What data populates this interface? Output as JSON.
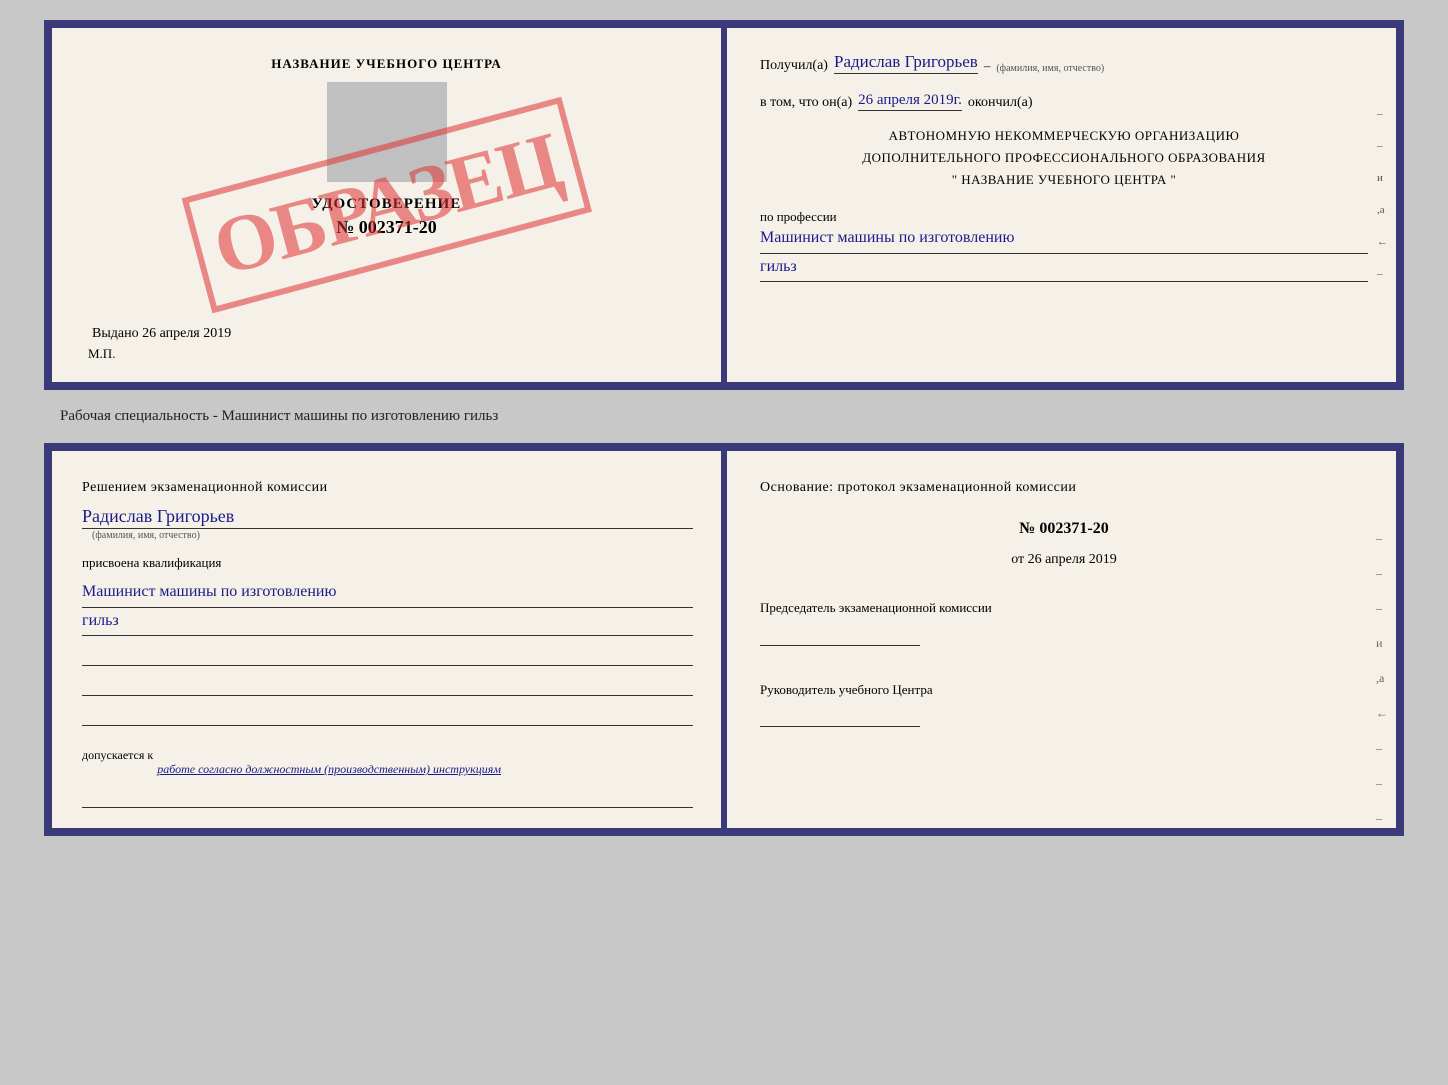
{
  "top_doc": {
    "left": {
      "title": "НАЗВАНИЕ УЧЕБНОГО ЦЕНТРА",
      "watermark": "ОБРАЗЕЦ",
      "cert_label": "УДОСТОВЕРЕНИЕ",
      "cert_number": "№ 002371-20",
      "issued_label": "Выдано",
      "issued_date": "26 апреля 2019",
      "mp_label": "М.П."
    },
    "right": {
      "received_prefix": "Получил(а)",
      "received_name": "Радислав Григорьев",
      "name_note": "(фамилия, имя, отчество)",
      "date_prefix": "в том, что он(а)",
      "date_value": "26 апреля 2019г.",
      "date_suffix": "окончил(а)",
      "org_line1": "АВТОНОМНУЮ НЕКОММЕРЧЕСКУЮ ОРГАНИЗАЦИЮ",
      "org_line2": "ДОПОЛНИТЕЛЬНОГО ПРОФЕССИОНАЛЬНОГО ОБРАЗОВАНИЯ",
      "org_line3": "\" НАЗВАНИЕ УЧЕБНОГО ЦЕНТРА \"",
      "profession_label": "по профессии",
      "profession_name": "Машинист машины по изготовлению",
      "profession_name2": "гильз"
    }
  },
  "between_label": "Рабочая специальность - Машинист машины по изготовлению гильз",
  "bottom_doc": {
    "left": {
      "decision_text": "Решением  экзаменационной  комиссии",
      "person_name": "Радислав Григорьев",
      "name_note": "(фамилия, имя, отчество)",
      "qualification_label": "присвоена квалификация",
      "qualification_name": "Машинист машины по изготовлению",
      "qualification_name2": "гильз",
      "allow_prefix": "допускается к",
      "allow_text": "работе согласно должностным (производственным) инструкциям"
    },
    "right": {
      "basis_text": "Основание:  протокол  экзаменационной  комиссии",
      "protocol_number": "№  002371-20",
      "protocol_date_prefix": "от",
      "protocol_date": "26 апреля 2019",
      "chairman_label": "Председатель экзаменационной комиссии",
      "director_label": "Руководитель учебного Центра"
    }
  }
}
